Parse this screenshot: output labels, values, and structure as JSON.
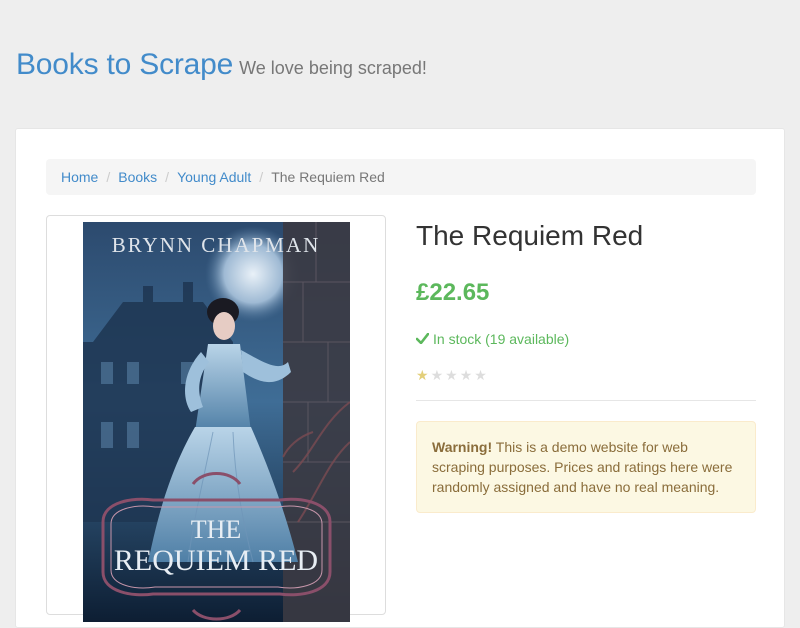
{
  "header": {
    "brand": "Books to Scrape",
    "tagline": "We love being scraped!"
  },
  "breadcrumb": {
    "items": [
      "Home",
      "Books",
      "Young Adult"
    ],
    "active": "The Requiem Red",
    "separator": "/"
  },
  "product": {
    "title": "The Requiem Red",
    "price": "£22.65",
    "availability": "In stock (19 available)",
    "rating": 1,
    "rating_max": 5
  },
  "cover": {
    "author": "BRYNN CHAPMAN",
    "title_line1": "THE",
    "title_line2": "REQUIEM RED"
  },
  "alert": {
    "strong": "Warning!",
    "text": " This is a demo website for web scraping purposes. Prices and ratings here were randomly assigned and have no real meaning."
  },
  "colors": {
    "brand": "#428bca",
    "price": "#5cb85c",
    "star_on": "#e3cf7a",
    "star_off": "#dddddd",
    "alert_bg": "#fcf8e3",
    "alert_text": "#8a6d3b"
  },
  "icons": {
    "stock": "check-icon",
    "rating": "star-icon"
  }
}
